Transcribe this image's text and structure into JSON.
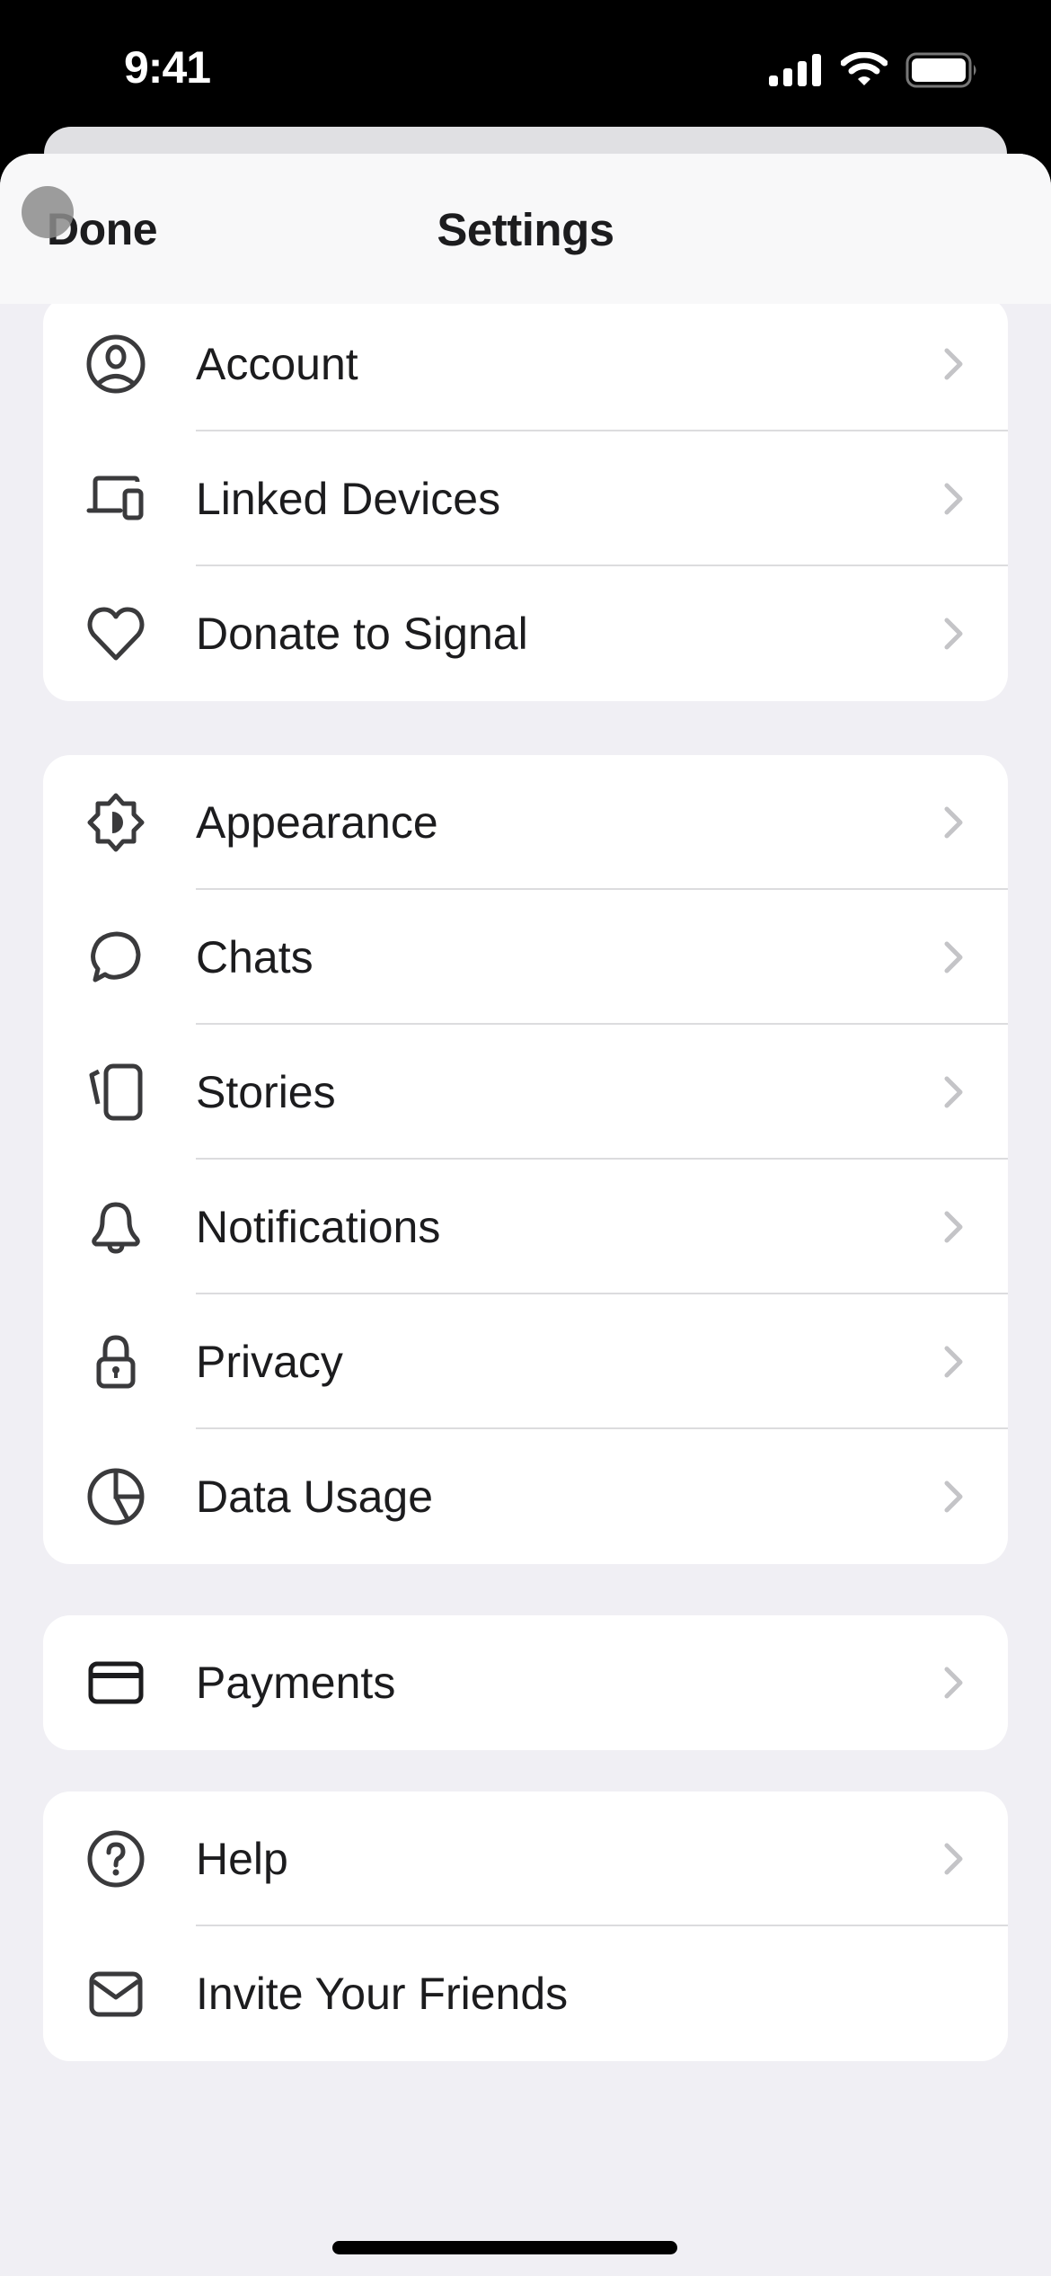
{
  "status_bar": {
    "time": "9:41",
    "icons": [
      "cellular-signal-icon",
      "wifi-icon",
      "battery-icon"
    ]
  },
  "header": {
    "title": "Settings",
    "done_label": "Done"
  },
  "colors": {
    "background": "#f0eff4",
    "card": "#ffffff",
    "text": "#1c1c1e",
    "icon": "#3a3a3c",
    "chevron": "#c4c4c7",
    "divider": "#dcdcde"
  },
  "sections": [
    {
      "items": [
        {
          "label": "Account",
          "icon": "account-icon",
          "chevron": true
        },
        {
          "label": "Linked Devices",
          "icon": "linked-devices-icon",
          "chevron": true
        },
        {
          "label": "Donate to Signal",
          "icon": "heart-icon",
          "chevron": true
        }
      ]
    },
    {
      "items": [
        {
          "label": "Appearance",
          "icon": "appearance-icon",
          "chevron": true
        },
        {
          "label": "Chats",
          "icon": "chat-bubble-icon",
          "chevron": true
        },
        {
          "label": "Stories",
          "icon": "stories-icon",
          "chevron": true
        },
        {
          "label": "Notifications",
          "icon": "bell-icon",
          "chevron": true
        },
        {
          "label": "Privacy",
          "icon": "lock-icon",
          "chevron": true
        },
        {
          "label": "Data Usage",
          "icon": "pie-chart-icon",
          "chevron": true
        }
      ]
    },
    {
      "items": [
        {
          "label": "Payments",
          "icon": "credit-card-icon",
          "chevron": true
        }
      ]
    },
    {
      "items": [
        {
          "label": "Help",
          "icon": "help-icon",
          "chevron": true
        },
        {
          "label": "Invite Your Friends",
          "icon": "envelope-icon",
          "chevron": false
        }
      ]
    }
  ]
}
